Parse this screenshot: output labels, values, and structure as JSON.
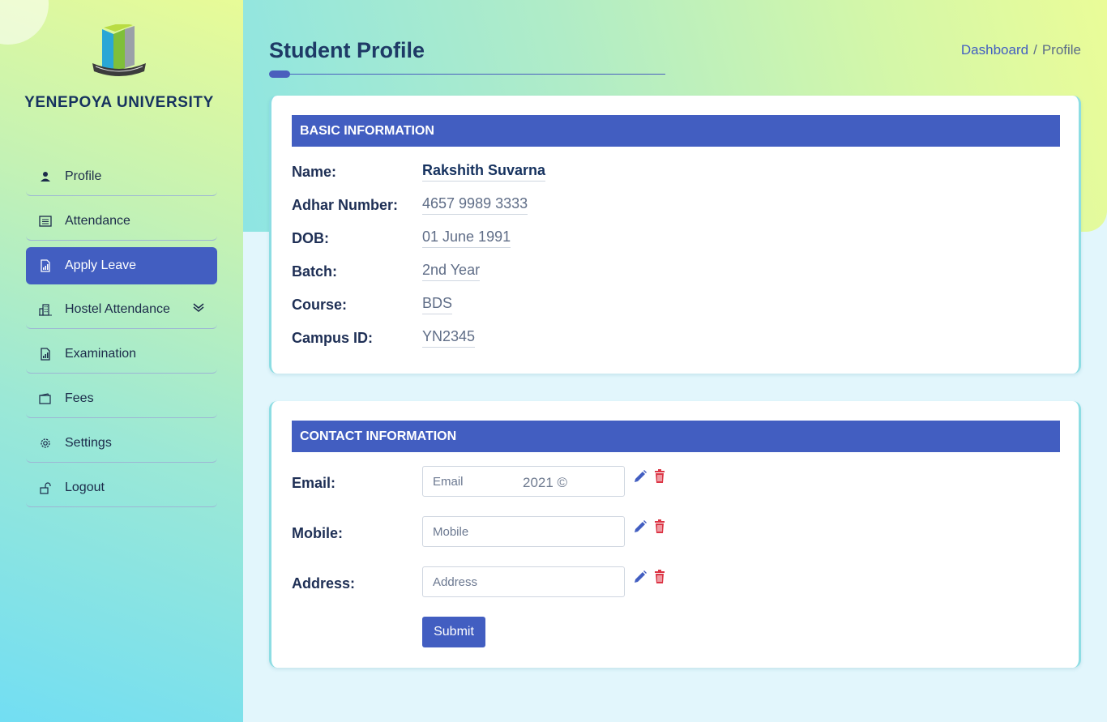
{
  "sidebar": {
    "university": "YENEPOYA UNIVERSITY",
    "items": [
      {
        "label": "Profile",
        "icon": "person-icon"
      },
      {
        "label": "Attendance",
        "icon": "list-icon"
      },
      {
        "label": "Apply Leave",
        "icon": "report-icon"
      },
      {
        "label": "Hostel Attendance",
        "icon": "building-icon"
      },
      {
        "label": "Examination",
        "icon": "report-icon"
      },
      {
        "label": "Fees",
        "icon": "wallet-icon"
      },
      {
        "label": "Settings",
        "icon": "gear-icon"
      },
      {
        "label": "Logout",
        "icon": "unlock-icon"
      }
    ],
    "active_item": "Apply Leave"
  },
  "header": {
    "title": "Student Profile",
    "breadcrumb": {
      "home": "Dashboard",
      "separator": "/",
      "current": "Profile"
    }
  },
  "basic": {
    "heading": "BASIC INFORMATION",
    "fields": [
      {
        "label": "Name:",
        "value": "Rakshith Suvarna"
      },
      {
        "label": "Adhar Number:",
        "value": "4657 9989 3333"
      },
      {
        "label": "DOB:",
        "value": "01 June 1991"
      },
      {
        "label": "Batch:",
        "value": "2nd Year"
      },
      {
        "label": "Course:",
        "value": "BDS"
      },
      {
        "label": "Campus ID:",
        "value": "YN2345"
      }
    ]
  },
  "contact": {
    "heading": "CONTACT INFORMATION",
    "email": {
      "label": "Email:",
      "placeholder": "Email"
    },
    "mobile": {
      "label": "Mobile:",
      "placeholder": "Mobile"
    },
    "address": {
      "label": "Address:",
      "placeholder": "Address"
    },
    "watermark": "2021 ©",
    "submit_label": "Submit"
  },
  "colors": {
    "accent": "#425ec1",
    "danger": "#dc3545",
    "heading_text": "#1e3a66"
  }
}
